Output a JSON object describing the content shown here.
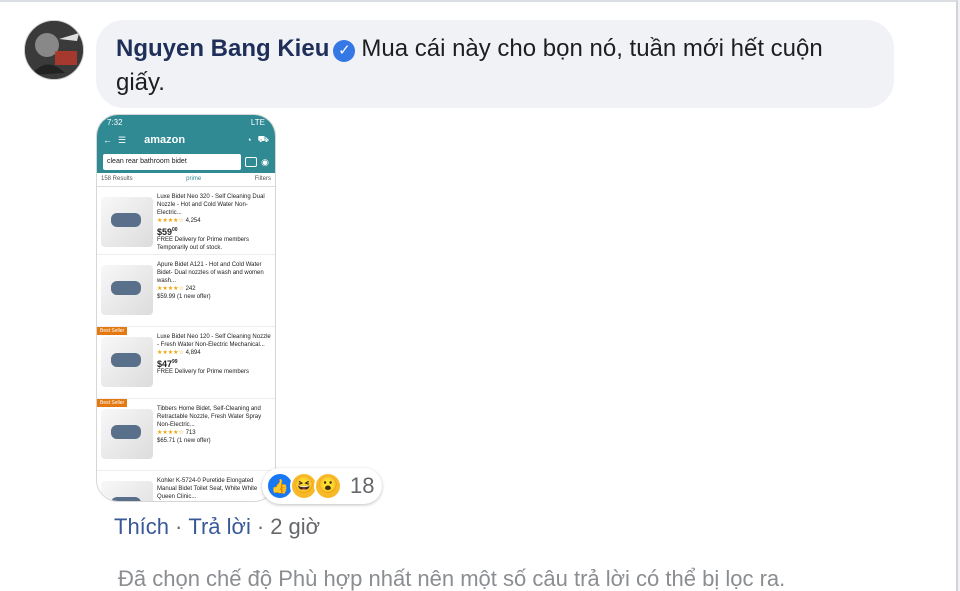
{
  "comment": {
    "author": "Nguyen Bang Kieu",
    "verified_icon": "verified-badge-icon",
    "text_line1": "Mua cái này cho bọn nó, tuần mới hết cuộn",
    "text_line2": "giấy."
  },
  "attachment": {
    "status_time": "7:32",
    "status_right": "LTE",
    "logo": "amazon",
    "search_query": "clean rear bathroom bidet",
    "results_count": "158 Results",
    "prime_label": "prime",
    "filters_label": "Filters",
    "products": [
      {
        "title": "Luxe Bidet Neo 320 - Self Cleaning Dual Nozzle - Hot and Cold Water Non-Electric...",
        "stars": "★★★★☆",
        "reviews": "4,254",
        "price": "$59",
        "cents": "00",
        "note": "FREE Delivery for Prime members",
        "note2": "Temporarily out of stock.",
        "best_seller": ""
      },
      {
        "title": "Apure Bidet A121 - Hot and Cold Water Bidet- Dual nozzles of wash and women wash...",
        "stars": "★★★★☆",
        "reviews": "242",
        "price": "$59.99",
        "cents": "",
        "note": "(1 new offer)",
        "note2": "",
        "best_seller": ""
      },
      {
        "title": "Luxe Bidet Neo 120 - Self Cleaning Nozzle - Fresh Water Non-Electric Mechanical...",
        "stars": "★★★★☆",
        "reviews": "4,894",
        "price": "$47",
        "cents": "99",
        "note": "FREE Delivery for Prime members",
        "note2": "",
        "best_seller": "Best Seller"
      },
      {
        "title": "Tibbers Home Bidet, Self-Cleaning and Retractable Nozzle, Fresh Water Spray Non-Electric...",
        "stars": "★★★★☆",
        "reviews": "713",
        "price": "$65.71",
        "cents": "",
        "note": "(1 new offer)",
        "note2": "",
        "best_seller": "Best Seller"
      },
      {
        "title": "Kohler K-5724-0 Puretide Elongated Manual Bidet Toilet Seat, White White Queen Clinic...",
        "stars": "",
        "reviews": "",
        "price": "",
        "cents": "",
        "note": "",
        "note2": "",
        "best_seller": ""
      }
    ]
  },
  "reactions": {
    "count": "18",
    "icons": [
      "like-icon",
      "haha-icon",
      "wow-icon"
    ],
    "like_glyph": "👍",
    "haha_glyph": "😆",
    "wow_glyph": "😮"
  },
  "actions": {
    "like": "Thích",
    "reply": "Trả lời",
    "sep": "·",
    "time": "2 giờ"
  },
  "filter_note": "Đã chọn chế độ Phù hợp nhất nên một số câu trả lời có thể bị lọc ra."
}
